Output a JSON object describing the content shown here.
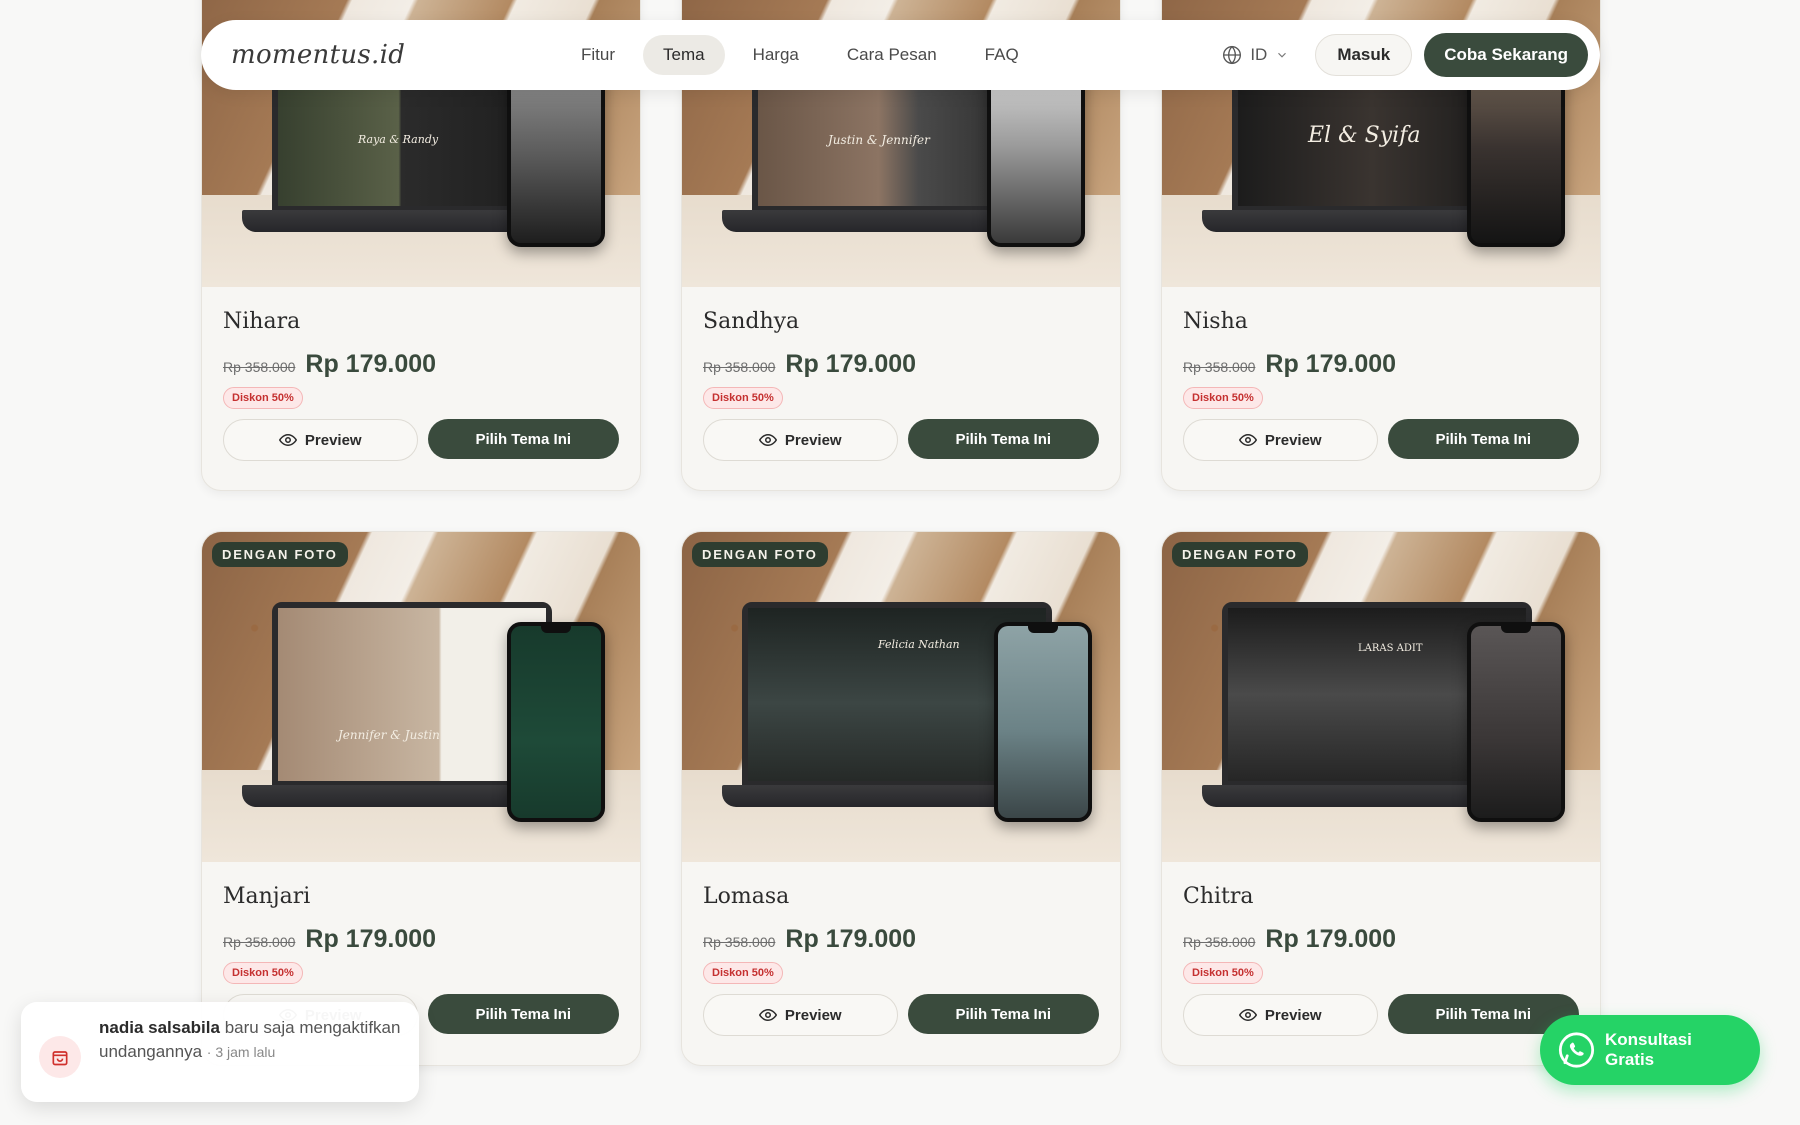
{
  "nav": {
    "logo": "momentus.id",
    "links": [
      "Fitur",
      "Tema",
      "Harga",
      "Cara Pesan",
      "FAQ"
    ],
    "active_link": "Tema",
    "lang": "ID",
    "login_label": "Masuk",
    "cta_label": "Coba Sekarang"
  },
  "common": {
    "badge": "DENGAN FOTO",
    "preview_label": "Preview",
    "choose_label": "Pilih Tema Ini",
    "old_price": "Rp 358.000",
    "new_price": "Rp 179.000",
    "discount": "Diskon 50%"
  },
  "themes": [
    {
      "name": "Nihara",
      "screen_text": "Raya & Randy"
    },
    {
      "name": "Sandhya",
      "screen_text": "Justin & Jennifer"
    },
    {
      "name": "Nisha",
      "screen_text": "El & Syifa"
    },
    {
      "name": "Manjari",
      "screen_text": "Jennifer & Justin"
    },
    {
      "name": "Lomasa",
      "screen_text": "Felicia Nathan"
    },
    {
      "name": "Chitra",
      "screen_text": "LARAS ADIT"
    }
  ],
  "toast": {
    "name": "nadia salsabila",
    "message": "baru saja mengaktifkan undangannya",
    "time": "3 jam lalu"
  },
  "whatsapp": {
    "label": "Konsultasi Gratis"
  },
  "colors": {
    "primary": "#3a4b3d",
    "whatsapp": "#25d366",
    "discount_text": "#c53030",
    "discount_bg": "#fde8e8"
  }
}
